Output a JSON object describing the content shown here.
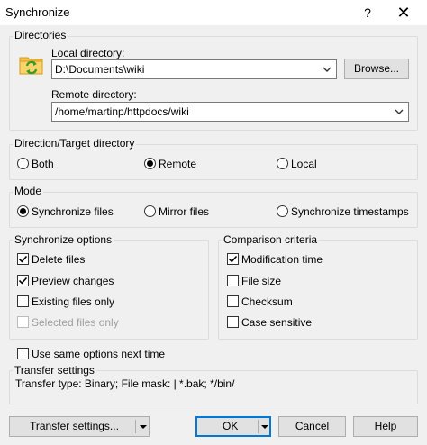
{
  "window": {
    "title": "Synchronize",
    "help": "?",
    "close": "✕"
  },
  "directories": {
    "group_label": "Directories",
    "local_label": "Local directory:",
    "local_value": "D:\\Documents\\wiki",
    "browse_label": "Browse...",
    "remote_label": "Remote directory:",
    "remote_value": "/home/martinp/httpdocs/wiki"
  },
  "direction": {
    "group_label": "Direction/Target directory",
    "options": [
      "Both",
      "Remote",
      "Local"
    ],
    "selected": "Remote"
  },
  "mode": {
    "group_label": "Mode",
    "options": [
      "Synchronize files",
      "Mirror files",
      "Synchronize timestamps"
    ],
    "selected": "Synchronize files"
  },
  "sync_options": {
    "group_label": "Synchronize options",
    "items": [
      {
        "label": "Delete files",
        "checked": true,
        "enabled": true
      },
      {
        "label": "Preview changes",
        "checked": true,
        "enabled": true
      },
      {
        "label": "Existing files only",
        "checked": false,
        "enabled": true
      },
      {
        "label": "Selected files only",
        "checked": false,
        "enabled": false
      }
    ]
  },
  "comparison": {
    "group_label": "Comparison criteria",
    "items": [
      {
        "label": "Modification time",
        "checked": true
      },
      {
        "label": "File size",
        "checked": false
      },
      {
        "label": "Checksum",
        "checked": false
      },
      {
        "label": "Case sensitive",
        "checked": false
      }
    ]
  },
  "same_options": {
    "label": "Use same options next time",
    "checked": false
  },
  "transfer": {
    "group_label": "Transfer settings",
    "summary": "Transfer type: Binary; File mask: | *.bak; */bin/"
  },
  "buttons": {
    "transfer_settings": "Transfer settings...",
    "ok": "OK",
    "cancel": "Cancel",
    "help": "Help"
  },
  "icons": {
    "sync_folder": "folder-sync-icon",
    "dropdown": "chevron-down-icon",
    "checkmark": "checkmark-icon"
  }
}
